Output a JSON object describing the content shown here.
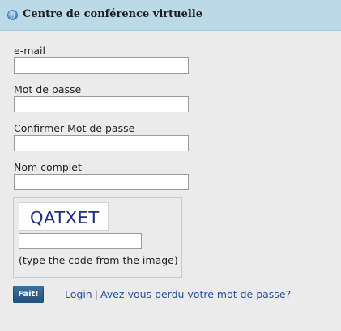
{
  "header": {
    "title": "Centre de conférence virtuelle",
    "icon": "globe-icon"
  },
  "form": {
    "email_label": "e-mail",
    "email_value": "",
    "password_label": "Mot de passe",
    "password_value": "",
    "confirm_password_label": "Confirmer Mot de passe",
    "confirm_password_value": "",
    "full_name_label": "Nom complet",
    "full_name_value": "",
    "captcha": {
      "image_text": "QATXET",
      "input_value": "",
      "hint": "(type the code from the image)"
    },
    "submit_label": "Fait!"
  },
  "links": {
    "login": "Login",
    "separator": "|",
    "forgot_password": "Avez-vous perdu votre mot de passe?"
  },
  "colors": {
    "header_background": "#bcd9e8",
    "page_background": "#ebebeb",
    "button_background": "#2b5a8a",
    "link": "#27509b",
    "captcha_text": "#1c2d86"
  }
}
